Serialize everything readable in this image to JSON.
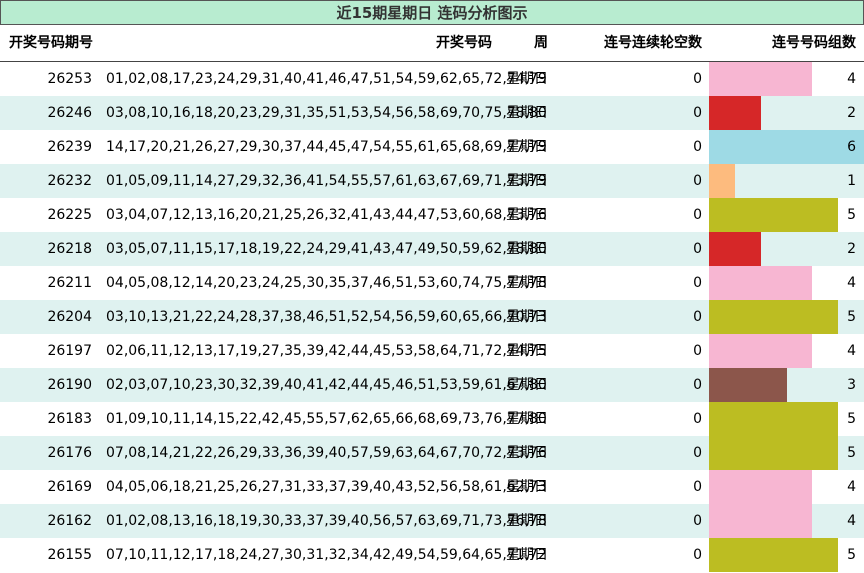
{
  "title": "近15期星期日 连码分析图示",
  "headers": {
    "issue": "开奖号码期号",
    "numbers": "开奖号码",
    "week": "周",
    "gap": "连号连续轮空数",
    "groups": "连号号码组数"
  },
  "colors": {
    "1": "#fdbb7e",
    "2": "#d62728",
    "3": "#8c564b",
    "4": "#f7b6d2",
    "5": "#bcbd22",
    "6": "#9edae5"
  },
  "chart_data": {
    "type": "bar",
    "categories": [
      "26253",
      "26246",
      "26239",
      "26232",
      "26225",
      "26218",
      "26211",
      "26204",
      "26197",
      "26190",
      "26183",
      "26176",
      "26169",
      "26162",
      "26155"
    ],
    "series": [
      {
        "values": [
          4,
          2,
          6,
          1,
          5,
          2,
          4,
          5,
          4,
          3,
          5,
          5,
          4,
          4,
          5
        ]
      }
    ],
    "xlim": [
      0,
      6
    ]
  },
  "rows": [
    {
      "issue": "26253",
      "numbers": "01,02,08,17,23,24,29,31,40,41,46,47,51,54,59,62,65,72,74,79",
      "week": "星期日",
      "gap": "0",
      "groups": "4"
    },
    {
      "issue": "26246",
      "numbers": "03,08,10,16,18,20,23,29,31,35,51,53,54,56,58,69,70,75,78,80",
      "week": "星期日",
      "gap": "0",
      "groups": "2"
    },
    {
      "issue": "26239",
      "numbers": "14,17,20,21,26,27,29,30,37,44,45,47,54,55,61,65,68,69,77,79",
      "week": "星期日",
      "gap": "0",
      "groups": "6"
    },
    {
      "issue": "26232",
      "numbers": "01,05,09,11,14,27,29,32,36,41,54,55,57,61,63,67,69,71,73,79",
      "week": "星期日",
      "gap": "0",
      "groups": "1"
    },
    {
      "issue": "26225",
      "numbers": "03,04,07,12,13,16,20,21,25,26,32,41,43,44,47,53,60,68,73,76",
      "week": "星期日",
      "gap": "0",
      "groups": "5"
    },
    {
      "issue": "26218",
      "numbers": "03,05,07,11,15,17,18,19,22,24,29,41,43,47,49,50,59,62,78,80",
      "week": "星期日",
      "gap": "0",
      "groups": "2"
    },
    {
      "issue": "26211",
      "numbers": "04,05,08,12,14,20,23,24,25,30,35,37,46,51,53,60,74,75,77,78",
      "week": "星期日",
      "gap": "0",
      "groups": "4"
    },
    {
      "issue": "26204",
      "numbers": "03,10,13,21,22,24,28,37,38,46,51,52,54,56,59,60,65,66,70,73",
      "week": "星期日",
      "gap": "0",
      "groups": "5"
    },
    {
      "issue": "26197",
      "numbers": "02,06,11,12,13,17,19,27,35,39,42,44,45,53,58,64,71,72,74,75",
      "week": "星期日",
      "gap": "0",
      "groups": "4"
    },
    {
      "issue": "26190",
      "numbers": "02,03,07,10,23,30,32,39,40,41,42,44,45,46,51,53,59,61,67,80",
      "week": "星期日",
      "gap": "0",
      "groups": "3"
    },
    {
      "issue": "26183",
      "numbers": "01,09,10,11,14,15,22,42,45,55,57,62,65,66,68,69,73,76,77,80",
      "week": "星期日",
      "gap": "0",
      "groups": "5"
    },
    {
      "issue": "26176",
      "numbers": "07,08,14,21,22,26,29,33,36,39,40,57,59,63,64,67,70,72,73,76",
      "week": "星期日",
      "gap": "0",
      "groups": "5"
    },
    {
      "issue": "26169",
      "numbers": "04,05,06,18,21,25,26,27,31,33,37,39,40,43,52,56,58,61,62,73",
      "week": "星期日",
      "gap": "0",
      "groups": "4"
    },
    {
      "issue": "26162",
      "numbers": "01,02,08,13,16,18,19,30,33,37,39,40,56,57,63,69,71,73,76,78",
      "week": "星期日",
      "gap": "0",
      "groups": "4"
    },
    {
      "issue": "26155",
      "numbers": "07,10,11,12,17,18,24,27,30,31,32,34,42,49,54,59,64,65,71,72",
      "week": "星期日",
      "gap": "0",
      "groups": "5"
    }
  ]
}
